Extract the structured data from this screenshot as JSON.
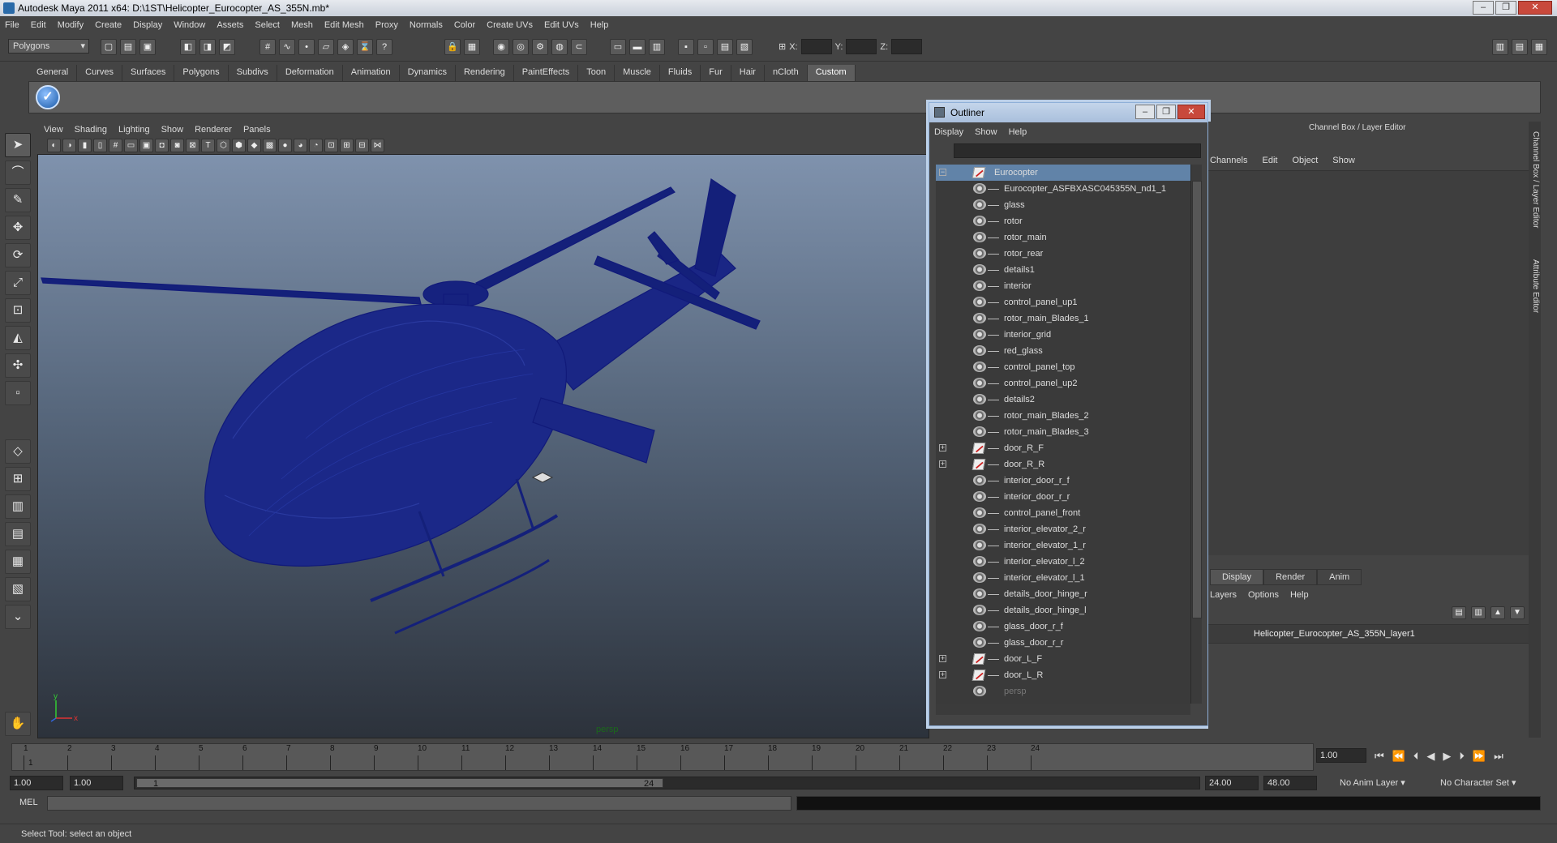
{
  "window": {
    "title": "Autodesk Maya 2011 x64: D:\\1ST\\Helicopter_Eurocopter_AS_355N.mb*",
    "controls": [
      "‒",
      "❐",
      "✕"
    ]
  },
  "menubar": [
    "File",
    "Edit",
    "Modify",
    "Create",
    "Display",
    "Window",
    "Assets",
    "Select",
    "Mesh",
    "Edit Mesh",
    "Proxy",
    "Normals",
    "Color",
    "Create UVs",
    "Edit UVs",
    "Help"
  ],
  "statusline": {
    "mode": "Polygons",
    "x_label": "X:",
    "y_label": "Y:",
    "z_label": "Z:"
  },
  "shelf": {
    "tabs": [
      "General",
      "Curves",
      "Surfaces",
      "Polygons",
      "Subdivs",
      "Deformation",
      "Animation",
      "Dynamics",
      "Rendering",
      "PaintEffects",
      "Toon",
      "Muscle",
      "Fluids",
      "Fur",
      "Hair",
      "nCloth",
      "Custom"
    ],
    "active_tab": "Custom"
  },
  "viewport": {
    "menu": [
      "View",
      "Shading",
      "Lighting",
      "Show",
      "Renderer",
      "Panels"
    ],
    "camera_label": "persp",
    "axis_x": "x",
    "axis_y": "y",
    "wire_color": "#111a7a"
  },
  "outliner": {
    "title": "Outliner",
    "menu": [
      "Display",
      "Show",
      "Help"
    ],
    "root": "Eurocopter",
    "items": [
      {
        "name": "Eurocopter_ASFBXASC045355N_nd1_1",
        "type": "mesh"
      },
      {
        "name": "glass",
        "type": "mesh"
      },
      {
        "name": "rotor",
        "type": "mesh"
      },
      {
        "name": "rotor_main",
        "type": "mesh"
      },
      {
        "name": "rotor_rear",
        "type": "mesh"
      },
      {
        "name": "details1",
        "type": "mesh"
      },
      {
        "name": "interior",
        "type": "mesh"
      },
      {
        "name": "control_panel_up1",
        "type": "mesh"
      },
      {
        "name": "rotor_main_Blades_1",
        "type": "mesh"
      },
      {
        "name": "interior_grid",
        "type": "mesh"
      },
      {
        "name": "red_glass",
        "type": "mesh"
      },
      {
        "name": "control_panel_top",
        "type": "mesh"
      },
      {
        "name": "control_panel_up2",
        "type": "mesh"
      },
      {
        "name": "details2",
        "type": "mesh"
      },
      {
        "name": "rotor_main_Blades_2",
        "type": "mesh"
      },
      {
        "name": "rotor_main_Blades_3",
        "type": "mesh"
      },
      {
        "name": "door_R_F",
        "type": "group"
      },
      {
        "name": "door_R_R",
        "type": "group"
      },
      {
        "name": "interior_door_r_f",
        "type": "mesh"
      },
      {
        "name": "interior_door_r_r",
        "type": "mesh"
      },
      {
        "name": "control_panel_front",
        "type": "mesh"
      },
      {
        "name": "interior_elevator_2_r",
        "type": "mesh"
      },
      {
        "name": "interior_elevator_1_r",
        "type": "mesh"
      },
      {
        "name": "interior_elevator_l_2",
        "type": "mesh"
      },
      {
        "name": "interior_elevator_l_1",
        "type": "mesh"
      },
      {
        "name": "details_door_hinge_r",
        "type": "mesh"
      },
      {
        "name": "details_door_hinge_l",
        "type": "mesh"
      },
      {
        "name": "glass_door_r_f",
        "type": "mesh"
      },
      {
        "name": "glass_door_r_r",
        "type": "mesh"
      },
      {
        "name": "door_L_F",
        "type": "group"
      },
      {
        "name": "door_L_R",
        "type": "group"
      }
    ],
    "camera": "persp"
  },
  "channelbox": {
    "title": "Channel Box / Layer Editor",
    "menu": [
      "Channels",
      "Edit",
      "Object",
      "Show"
    ],
    "layer_tabs": [
      "Display",
      "Render",
      "Anim"
    ],
    "layer_menu": [
      "Layers",
      "Options",
      "Help"
    ],
    "layer_name": "Helicopter_Eurocopter_AS_355N_layer1",
    "side_tabs": [
      "Channel Box / Layer Editor",
      "Attribute Editor"
    ]
  },
  "timeline": {
    "ticks": [
      "1",
      "2",
      "3",
      "4",
      "5",
      "6",
      "7",
      "8",
      "9",
      "10",
      "11",
      "12",
      "13",
      "14",
      "15",
      "16",
      "17",
      "18",
      "19",
      "20",
      "21",
      "22",
      "23",
      "24"
    ],
    "current_frame": "1.00",
    "playhead": "1",
    "play_controls": [
      "⏮",
      "⏪",
      "⏴",
      "◀",
      "▶",
      "⏵",
      "⏩",
      "⏭"
    ]
  },
  "range": {
    "start": "1.00",
    "playback_start": "1.00",
    "slider_start": "1",
    "slider_end": "24",
    "playback_end": "24.00",
    "end": "48.00",
    "anim_layer": "No Anim Layer",
    "char_set": "No Character Set"
  },
  "cmdline": {
    "label": "MEL"
  },
  "helpline": {
    "text": "Select Tool: select an object"
  }
}
